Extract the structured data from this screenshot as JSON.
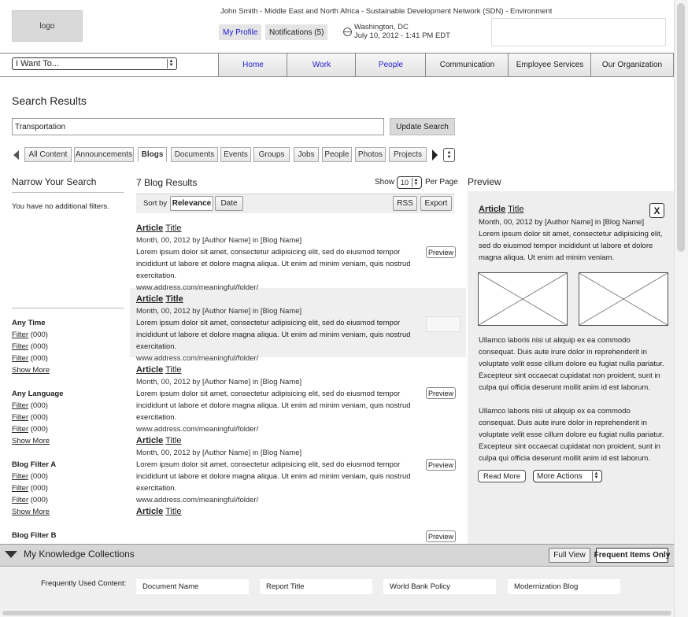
{
  "header": {
    "logo_text": "logo",
    "user_line": "John Smith - Middle East and North Africa - Sustainable Development Network (SDN) - Environment",
    "my_profile": "My Profile",
    "notifications": "Notifications (5)",
    "location_city": "Washington, DC",
    "location_datetime": "July 10, 2012 - 1:41 PM EDT"
  },
  "nav": {
    "i_want_to": "I Want To...",
    "tabs": [
      "Home",
      "Work",
      "People",
      "Communication",
      "Employee Services",
      "Our Organization"
    ]
  },
  "search": {
    "title": "Search Results",
    "query": "Transportation",
    "update_button": "Update Search",
    "filter_tabs": [
      "All Content",
      "Announcements",
      "Blogs",
      "Documents",
      "Events",
      "Groups",
      "Jobs",
      "People",
      "Photos",
      "Projects"
    ],
    "active_tab": "Blogs"
  },
  "narrow": {
    "title": "Narrow Your Search",
    "no_filters": "You have no additional filters.",
    "groups": [
      {
        "title": "Any Time",
        "items": [
          "Filter",
          "Filter",
          "Filter"
        ],
        "count": "(000)",
        "more": "Show More"
      },
      {
        "title": "Any Language",
        "items": [
          "Filter",
          "Filter",
          "Filter"
        ],
        "count": "(000)",
        "more": "Show More"
      },
      {
        "title": "Blog Filter A",
        "items": [
          "Filter",
          "Filter",
          "Filter"
        ],
        "count": "(000)",
        "more": "Show More"
      },
      {
        "title": "Blog Filter B",
        "items": [],
        "count": "",
        "more": ""
      }
    ]
  },
  "results": {
    "count_label": "7 Blog Results",
    "show_label": "Show",
    "show_value": "10",
    "per_page": "Per Page",
    "sort_by": "Sort by",
    "sort_options": [
      "Relevance",
      "Date"
    ],
    "active_sort": "Relevance",
    "rss": "RSS",
    "export": "Export",
    "preview_label": "Preview",
    "items": [
      {
        "title_a": "Article",
        "title_b": "Title",
        "meta": "Month, 00, 2012 by [Author Name] in [Blog Name]",
        "body": "Lorem ipsum dolor sit amet, consectetur adipisicing elit, sed do eiusmod tempor incididunt ut labore et dolore magna aliqua. Ut enim ad minim veniam, quis nostrud exercitation.",
        "url": "www.address.com/meaningful/folder/"
      },
      {
        "title_a": "Article",
        "title_b": "Title",
        "meta": "Month, 00, 2012 by [Author Name] in [Blog Name]",
        "body": "Lorem ipsum dolor sit amet, consectetur adipisicing elit, sed do eiusmod tempor incididunt ut labore et dolore magna aliqua. Ut enim ad minim veniam, quis nostrud exercitation.",
        "url": "www.address.com/meaningful/folder/"
      },
      {
        "title_a": "Article",
        "title_b": "Title",
        "meta": "Month, 00, 2012 by [Author Name] in [Blog Name]",
        "body": "Lorem ipsum dolor sit amet, consectetur adipisicing elit, sed do eiusmod tempor incididunt ut labore et dolore magna aliqua. Ut enim ad minim veniam, quis nostrud exercitation.",
        "url": "www.address.com/meaningful/folder/"
      },
      {
        "title_a": "Article",
        "title_b": "Title",
        "meta": "Month, 00, 2012 by [Author Name] in [Blog Name]",
        "body": "Lorem ipsum dolor sit amet, consectetur adipisicing elit, sed do eiusmod tempor incididunt ut labore et dolore magna aliqua. Ut enim ad minim veniam, quis nostrud exercitation.",
        "url": "www.address.com/meaningful/folder/"
      },
      {
        "title_a": "Article",
        "title_b": "Title",
        "meta": "",
        "body": "",
        "url": ""
      }
    ]
  },
  "preview": {
    "title": "Preview",
    "article_a": "Article",
    "article_b": "Title",
    "close": "X",
    "meta": "Month, 00, 2012 by [Author Name] in [Blog Name]",
    "intro": "Lorem ipsum dolor sit amet, consectetur adipisicing elit, sed do eiusmod tempor incididunt ut labore et dolore magna aliqua. Ut enim ad minim veniam.",
    "para1": "Ullamco laboris nisi ut aliquip ex ea commodo consequat. Duis aute irure dolor in reprehenderit in voluptate velit esse cillum dolore eu fugiat nulla pariatur. Excepteur sint occaecat cupidatat non proident, sunt in culpa qui officia deserunt mollit anim id est laborum.",
    "para2": "Ullamco laboris nisi ut aliquip ex ea commodo consequat. Duis aute irure dolor in reprehenderit in voluptate velit esse cillum dolore eu fugiat nulla pariatur. Excepteur sint occaecat cupidatat non proident, sunt in culpa qui officia deserunt mollit anim id est laborum.",
    "read_more": "Read More",
    "more_actions": "More Actions"
  },
  "knowledge": {
    "title": "My Knowledge Collections",
    "full_view": "Full View",
    "frequent_only": "Frequent Items Only",
    "frequently_used_label": "Frequently Used Content:",
    "items": [
      "Document Name",
      "Report Title",
      "World Bank Policy",
      "Modernization Blog"
    ]
  }
}
